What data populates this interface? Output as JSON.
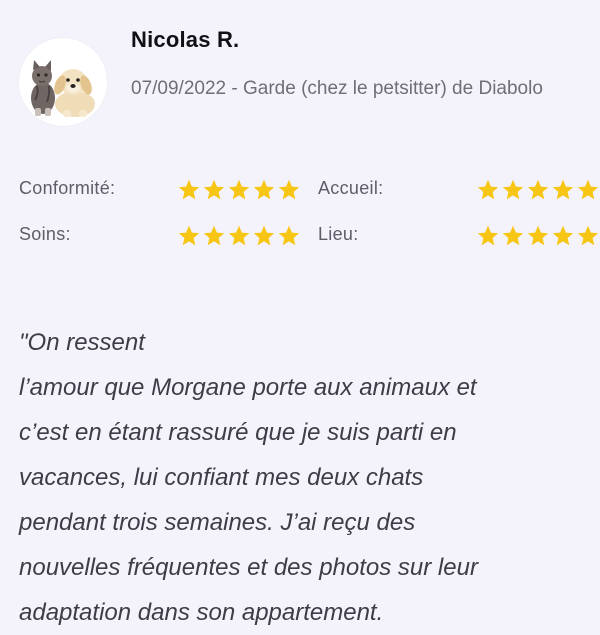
{
  "review": {
    "reviewer_name": "Nicolas R.",
    "meta": "07/09/2022 - Garde (chez le petsitter) de Diabolo",
    "avatar_icon": "cat-and-dog-avatar-icon",
    "ratings": [
      {
        "label": "Conformité:",
        "stars": 5,
        "max": 5
      },
      {
        "label": "Accueil:",
        "stars": 5,
        "max": 5
      },
      {
        "label": "Soins:",
        "stars": 5,
        "max": 5
      },
      {
        "label": "Lieu:",
        "stars": 5,
        "max": 5
      }
    ],
    "star_color": "#f7c514",
    "comment": "\"On ressent\nl’amour que Morgane porte aux animaux et\nc’est en étant rassuré que je suis parti en\nvacances, lui confiant mes deux chats\npendant trois semaines. J’ai reçu des\nnouvelles fréquentes et des photos sur leur\nadaptation dans son appartement."
  }
}
